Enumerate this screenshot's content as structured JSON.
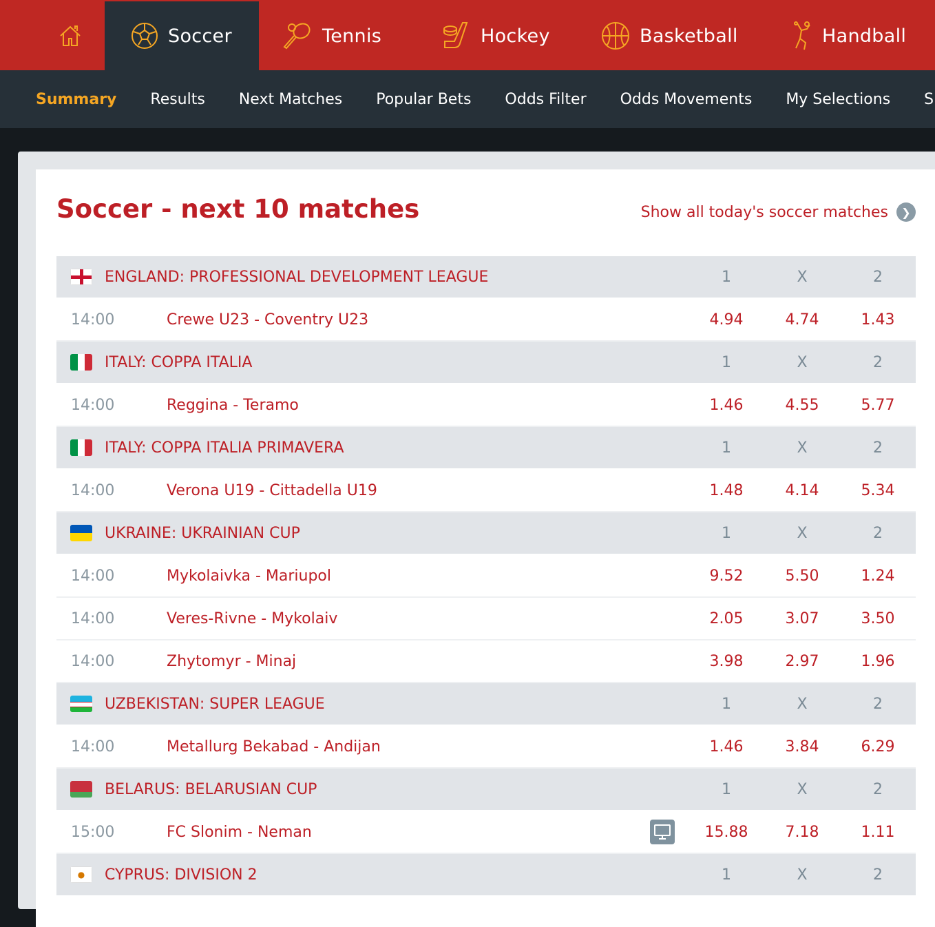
{
  "top_nav": [
    {
      "label": "",
      "icon": "home-icon"
    },
    {
      "label": "Soccer",
      "icon": "soccer-ball-icon",
      "active": true
    },
    {
      "label": "Tennis",
      "icon": "tennis-racket-icon"
    },
    {
      "label": "Hockey",
      "icon": "hockey-stick-icon"
    },
    {
      "label": "Basketball",
      "icon": "basketball-icon"
    },
    {
      "label": "Handball",
      "icon": "handball-player-icon"
    }
  ],
  "sub_nav": [
    "Summary",
    "Results",
    "Next Matches",
    "Popular Bets",
    "Odds Filter",
    "Odds Movements",
    "My Selections",
    "S"
  ],
  "title": "Soccer - next 10 matches",
  "show_all": "Show all today's soccer matches",
  "colors": {
    "brand_red": "#bf2823",
    "dark": "#263038",
    "accent": "#f5a623",
    "text_red": "#bd1f26"
  },
  "odds_headers": [
    "1",
    "X",
    "2"
  ],
  "leagues": [
    {
      "name": "England: Professional Development League",
      "flag": "england",
      "matches": [
        {
          "time": "14:00",
          "teams": "Crewe U23 - Coventry U23",
          "odds": [
            "4.94",
            "4.74",
            "1.43"
          ]
        }
      ]
    },
    {
      "name": "Italy: Coppa Italia",
      "flag": "italy",
      "matches": [
        {
          "time": "14:00",
          "teams": "Reggina - Teramo",
          "odds": [
            "1.46",
            "4.55",
            "5.77"
          ]
        }
      ]
    },
    {
      "name": "Italy: Coppa Italia Primavera",
      "flag": "italy",
      "matches": [
        {
          "time": "14:00",
          "teams": "Verona U19 - Cittadella U19",
          "odds": [
            "1.48",
            "4.14",
            "5.34"
          ]
        }
      ]
    },
    {
      "name": "Ukraine: Ukrainian Cup",
      "flag": "ukraine",
      "matches": [
        {
          "time": "14:00",
          "teams": "Mykolaivka - Mariupol",
          "odds": [
            "9.52",
            "5.50",
            "1.24"
          ]
        },
        {
          "time": "14:00",
          "teams": "Veres-Rivne - Mykolaiv",
          "odds": [
            "2.05",
            "3.07",
            "3.50"
          ]
        },
        {
          "time": "14:00",
          "teams": "Zhytomyr - Minaj",
          "odds": [
            "3.98",
            "2.97",
            "1.96"
          ]
        }
      ]
    },
    {
      "name": "Uzbekistan: Super League",
      "flag": "uzbekistan",
      "matches": [
        {
          "time": "14:00",
          "teams": "Metallurg Bekabad - Andijan",
          "odds": [
            "1.46",
            "3.84",
            "6.29"
          ]
        }
      ]
    },
    {
      "name": "Belarus: Belarusian Cup",
      "flag": "belarus",
      "matches": [
        {
          "time": "15:00",
          "teams": "FC Slonim - Neman",
          "odds": [
            "15.88",
            "7.18",
            "1.11"
          ],
          "tv": true
        }
      ]
    },
    {
      "name": "Cyprus: Division 2",
      "flag": "cyprus",
      "matches": []
    }
  ]
}
